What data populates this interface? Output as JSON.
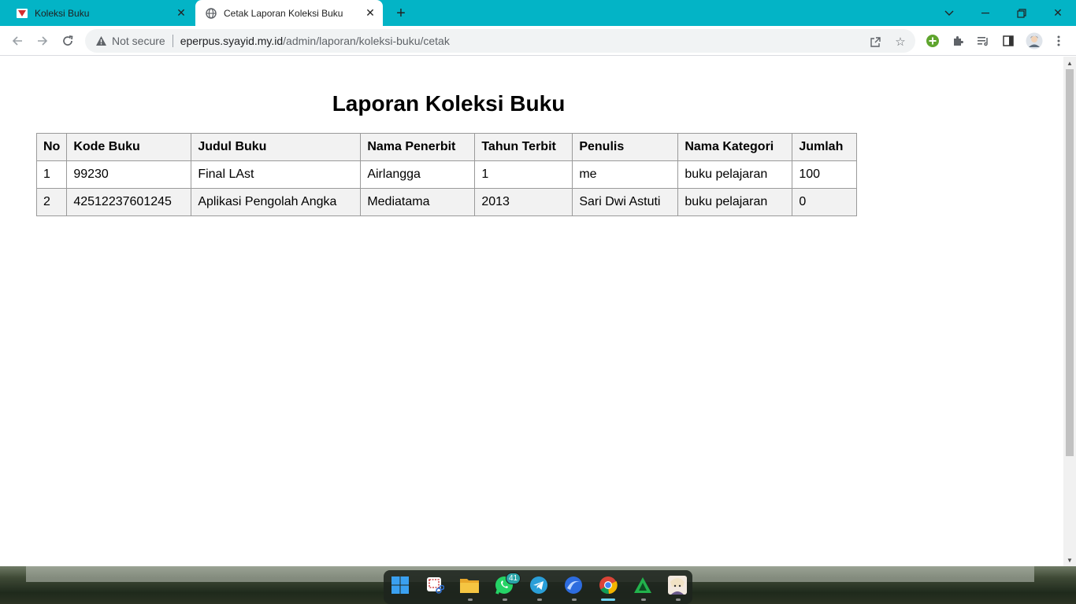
{
  "browser": {
    "tabs": [
      {
        "title": "Koleksi Buku",
        "active": false
      },
      {
        "title": "Cetak Laporan Koleksi Buku",
        "active": true
      }
    ],
    "omnibox": {
      "security_label": "Not secure",
      "host": "eperpus.syayid.my.id",
      "path": "/admin/laporan/koleksi-buku/cetak"
    },
    "tab_strip_color": "#03b4c6"
  },
  "report": {
    "title": "Laporan Koleksi Buku",
    "headers": [
      "No",
      "Kode Buku",
      "Judul Buku",
      "Nama Penerbit",
      "Tahun Terbit",
      "Penulis",
      "Nama Kategori",
      "Jumlah"
    ],
    "rows": [
      [
        "1",
        "99230",
        "Final LAst",
        "Airlangga",
        "1",
        "me",
        "buku pelajaran",
        "100"
      ],
      [
        "2",
        "42512237601245",
        "Aplikasi Pengolah Angka",
        "Mediatama",
        "2013",
        "Sari Dwi Astuti",
        "buku pelajaran",
        "0"
      ]
    ]
  },
  "taskbar": {
    "apps": [
      {
        "name": "windows-start-icon"
      },
      {
        "name": "snipping-tool-icon"
      },
      {
        "name": "file-explorer-icon"
      },
      {
        "name": "whatsapp-icon",
        "badge": "41"
      },
      {
        "name": "telegram-icon"
      },
      {
        "name": "browser-globe-icon"
      },
      {
        "name": "chrome-icon",
        "active": true
      },
      {
        "name": "green-triangle-app-icon"
      },
      {
        "name": "game-avatar-icon"
      }
    ]
  }
}
